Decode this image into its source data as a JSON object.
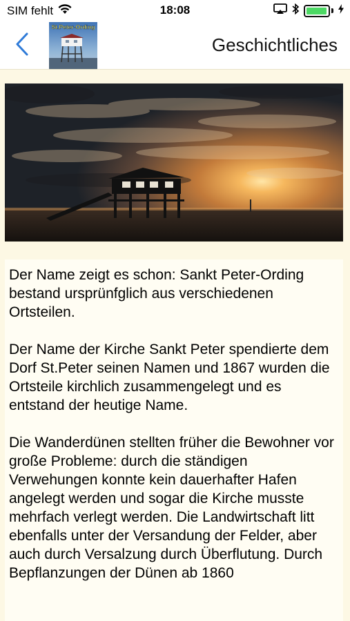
{
  "status_bar": {
    "carrier": "SIM fehlt",
    "time": "18:08",
    "battery_level": 0.95
  },
  "nav": {
    "title": "Geschichtliches",
    "app_logo_text": "St.Peter-Ording",
    "back_icon": "chevron-left-icon"
  },
  "hero": {
    "icon": "photo-stilt-house-sunset"
  },
  "article": {
    "paragraphs": [
      "Der Name zeigt es schon: Sankt Peter-Ording bestand ursprünfglich aus verschiedenen Ortsteilen.",
      "Der Name der Kirche Sankt Peter spendierte dem Dorf St.Peter seinen Namen und 1867 wurden die Ortsteile kirchlich zusammengelegt und es entstand der heutige Name.",
      "Die Wanderdünen stellten früher die Bewohner vor große Probleme: durch die ständigen Verwehungen konnte kein dauerhafter Hafen angelegt werden und sogar die Kirche musste mehrfach verlegt werden. Die Landwirtschaft litt ebenfalls unter der Versandung der Felder, aber auch durch Versalzung durch Überflutung. Durch Bepflanzungen der Dünen ab 1860"
    ]
  },
  "colors": {
    "accent": "#2f7bd8",
    "background": "#fdf8e4",
    "battery": "#4cd964"
  }
}
